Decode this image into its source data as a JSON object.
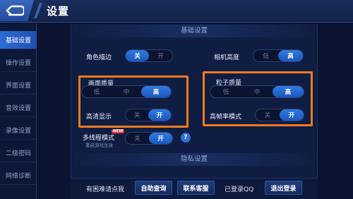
{
  "header": {
    "title": "设置"
  },
  "sidebar": {
    "items": [
      {
        "label": "基础设置"
      },
      {
        "label": "操作设置"
      },
      {
        "label": "界面设置"
      },
      {
        "label": "音效设置"
      },
      {
        "label": "录像设置"
      },
      {
        "label": "二级密码"
      },
      {
        "label": "网络诊断"
      }
    ]
  },
  "sections": {
    "basic": "基础设置",
    "privacy": "隐私设置"
  },
  "settings": {
    "character_outline": {
      "label": "角色描边",
      "options": [
        "关",
        "开"
      ],
      "selected": "关"
    },
    "camera_height": {
      "label": "相机高度",
      "options": [
        "低",
        "高"
      ],
      "selected": "高"
    },
    "picture_quality": {
      "label": "画面质量",
      "options": [
        "低",
        "中",
        "高"
      ],
      "selected": "高"
    },
    "particle_quality": {
      "label": "粒子质量",
      "options": [
        "低",
        "中",
        "高"
      ],
      "selected": "高"
    },
    "hd_display": {
      "label": "高清显示",
      "options": [
        "关",
        "开"
      ],
      "selected": "开"
    },
    "high_fps": {
      "label": "高帧率模式",
      "options": [
        "关",
        "开"
      ],
      "selected": "开"
    },
    "multithread": {
      "label": "多线程模式",
      "sublabel": "重启游戏生效",
      "badge": "NEW",
      "options": [
        "关",
        "开"
      ],
      "selected": "开"
    }
  },
  "help": "?",
  "footer": {
    "problem_text": "有困难请点我",
    "self_query": "自助查询",
    "contact_service": "联系客服",
    "login_status": "已登录QQ",
    "logout": "退出登录"
  },
  "colors": {
    "accent": "#2f7ae0",
    "highlight": "#f07a1e",
    "background": "#0a1430"
  }
}
